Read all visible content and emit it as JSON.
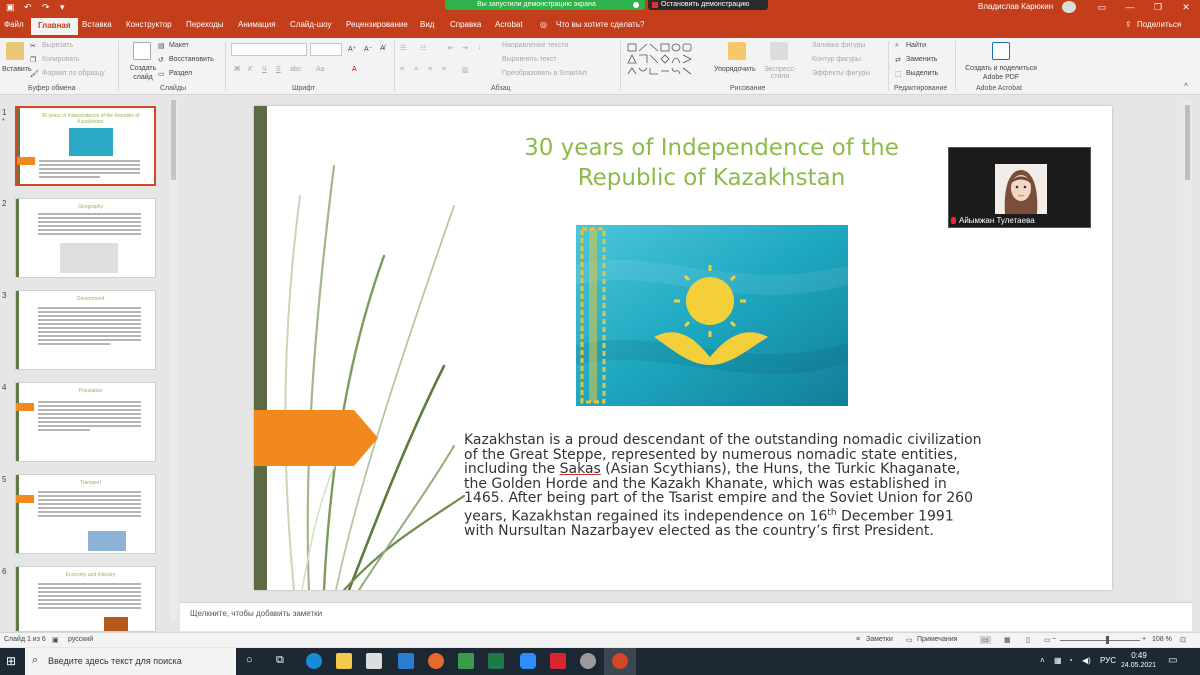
{
  "window": {
    "sharing_status": "Вы запустили демонстрацию экрана",
    "stop_sharing": "Остановить демонстрацию",
    "user_name": "Владислав Карюкин"
  },
  "tabs": [
    "Файл",
    "Главная",
    "Вставка",
    "Конструктор",
    "Переходы",
    "Анимация",
    "Слайд-шоу",
    "Рецензирование",
    "Вид",
    "Справка",
    "Acrobat"
  ],
  "tell_me": "Что вы хотите сделать?",
  "share": "Поделиться",
  "ribbon": {
    "clipboard": {
      "paste": "Вставить",
      "cut": "Вырезать",
      "copy": "Копировать",
      "format_painter": "Формат по образцу",
      "group": "Буфер обмена"
    },
    "slides": {
      "new_slide": "Создать слайд",
      "layout": "Макет",
      "reset": "Восстановить",
      "section": "Раздел",
      "group": "Слайды"
    },
    "font": {
      "group": "Шрифт",
      "bold": "Ж",
      "italic": "К",
      "underline": "Ч",
      "strike": "S",
      "spacing": "abc"
    },
    "paragraph": {
      "text_direction": "Направление текста",
      "align_text": "Выровнять текст",
      "smartart": "Преобразовать в SmartArt",
      "group": "Абзац"
    },
    "drawing": {
      "arrange": "Упорядочить",
      "quick_styles": "Экспресс-стили",
      "fill": "Заливка фигуры",
      "outline": "Контур фигуры",
      "effects": "Эффекты фигуры",
      "group": "Рисование"
    },
    "editing": {
      "find": "Найти",
      "replace": "Заменить",
      "select": "Выделить",
      "group": "Редактирование"
    },
    "acrobat": {
      "create_share": "Создать и поделиться Adobe PDF",
      "group": "Adobe Acrobat"
    }
  },
  "thumbnails": [
    {
      "num": "1",
      "title": "30 years of Independence of the Republic of Kazakhstan",
      "selected": true
    },
    {
      "num": "2",
      "title": "Geography",
      "selected": false
    },
    {
      "num": "3",
      "title": "Government",
      "selected": false
    },
    {
      "num": "4",
      "title": "Population",
      "selected": false
    },
    {
      "num": "5",
      "title": "Transport",
      "selected": false
    },
    {
      "num": "6",
      "title": "Economy and Industry",
      "selected": false
    }
  ],
  "slide": {
    "title_line1": "30 years of Independence of the",
    "title_line2": "Republic of Kazakhstan",
    "body_part1": "Kazakhstan is a proud descendant of the outstanding nomadic civilization of the Great Steppe, represented by numerous nomadic state entities, including the ",
    "body_underlined": "Sakas",
    "body_part2": " (Asian Scythians), the Huns, the Turkic Khaganate, the Golden Horde and the Kazakh Khanate, which was established in 1465. After being part of the Tsarist empire and the Soviet Union for 260 years, Kazakhstan regained its independence on 16",
    "body_sup": "th",
    "body_part3": " December 1991 with Nursultan Nazarbayev elected as the country’s first President.",
    "title_color": "#8dbb4b",
    "accent_color": "#f1891d",
    "bar_color": "#5d6b45"
  },
  "video": {
    "participant": "Айымжан Тулетаева"
  },
  "notes_placeholder": "Щелкните, чтобы добавить заметки",
  "statusbar": {
    "slide_info": "Слайд 1 из 6",
    "language": "русский",
    "notes": "Заметки",
    "comments": "Примечания",
    "zoom": "108 %"
  },
  "taskbar": {
    "search_placeholder": "Введите здесь текст для поиска",
    "lang": "РУС",
    "time": "0:49",
    "date": "24.05.2021"
  },
  "colors": {
    "ribbon_red": "#c43e1c",
    "taskbar": "#1c2833"
  }
}
